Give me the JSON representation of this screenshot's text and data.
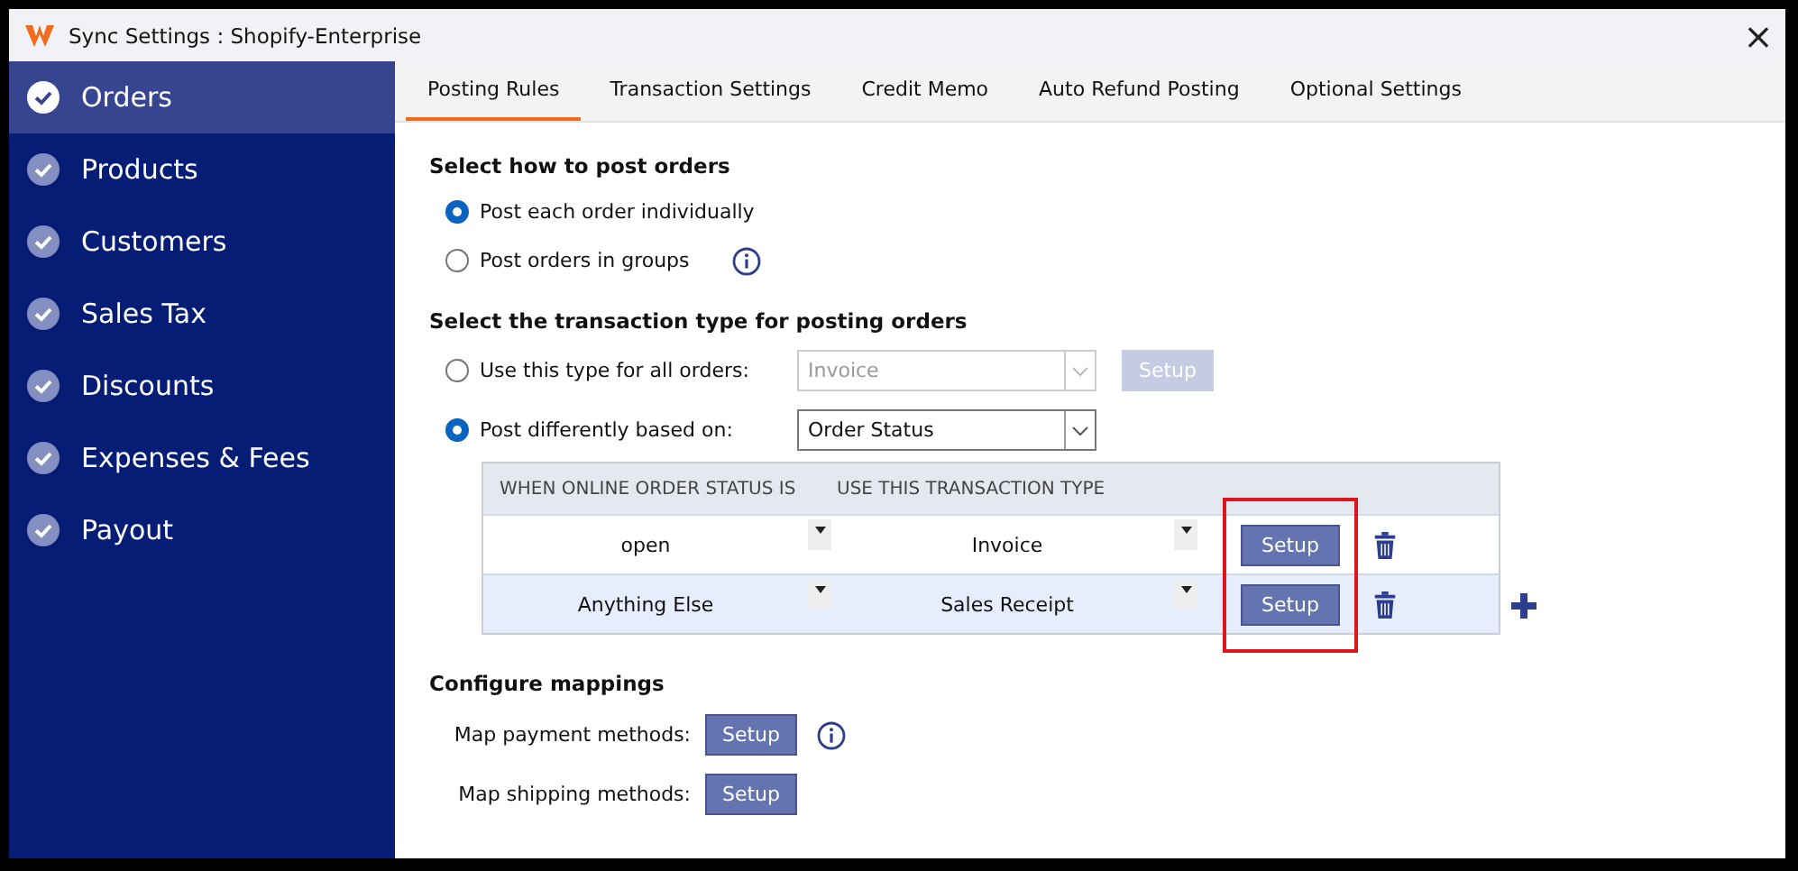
{
  "window": {
    "title": "Sync Settings : Shopify-Enterprise",
    "close": "×"
  },
  "sidebar": {
    "items": [
      {
        "label": "Orders",
        "selected": true
      },
      {
        "label": "Products",
        "selected": false
      },
      {
        "label": "Customers",
        "selected": false
      },
      {
        "label": "Sales Tax",
        "selected": false
      },
      {
        "label": "Discounts",
        "selected": false
      },
      {
        "label": "Expenses & Fees",
        "selected": false
      },
      {
        "label": "Payout",
        "selected": false
      }
    ]
  },
  "tabs": [
    {
      "label": "Posting Rules",
      "selected": true
    },
    {
      "label": "Transaction Settings",
      "selected": false
    },
    {
      "label": "Credit Memo",
      "selected": false
    },
    {
      "label": "Auto Refund Posting",
      "selected": false
    },
    {
      "label": "Optional Settings",
      "selected": false
    }
  ],
  "post_orders": {
    "heading": "Select how to post orders",
    "options": [
      {
        "label": "Post each order individually",
        "selected": true,
        "info": false
      },
      {
        "label": "Post orders in groups",
        "selected": false,
        "info": true
      }
    ]
  },
  "transaction_type": {
    "heading": "Select the transaction type for posting orders",
    "options": [
      {
        "label": "Use this type for all orders:",
        "selected": false,
        "value": "Invoice",
        "disabled": true,
        "button": "Setup"
      },
      {
        "label": "Post differently based on:",
        "selected": true,
        "value": "Order Status",
        "disabled": false
      }
    ],
    "table": {
      "columns": [
        "WHEN ONLINE ORDER STATUS IS",
        "USE THIS TRANSACTION TYPE"
      ],
      "rows": [
        {
          "status": "open",
          "type": "Invoice",
          "button": "Setup",
          "selected": false
        },
        {
          "status": "Anything Else",
          "type": "Sales Receipt",
          "button": "Setup",
          "selected": true
        }
      ]
    }
  },
  "mappings": {
    "heading": "Configure mappings",
    "items": [
      {
        "label": "Map payment methods:",
        "button": "Setup",
        "info": true
      },
      {
        "label": "Map shipping methods:",
        "button": "Setup",
        "info": false
      }
    ]
  }
}
